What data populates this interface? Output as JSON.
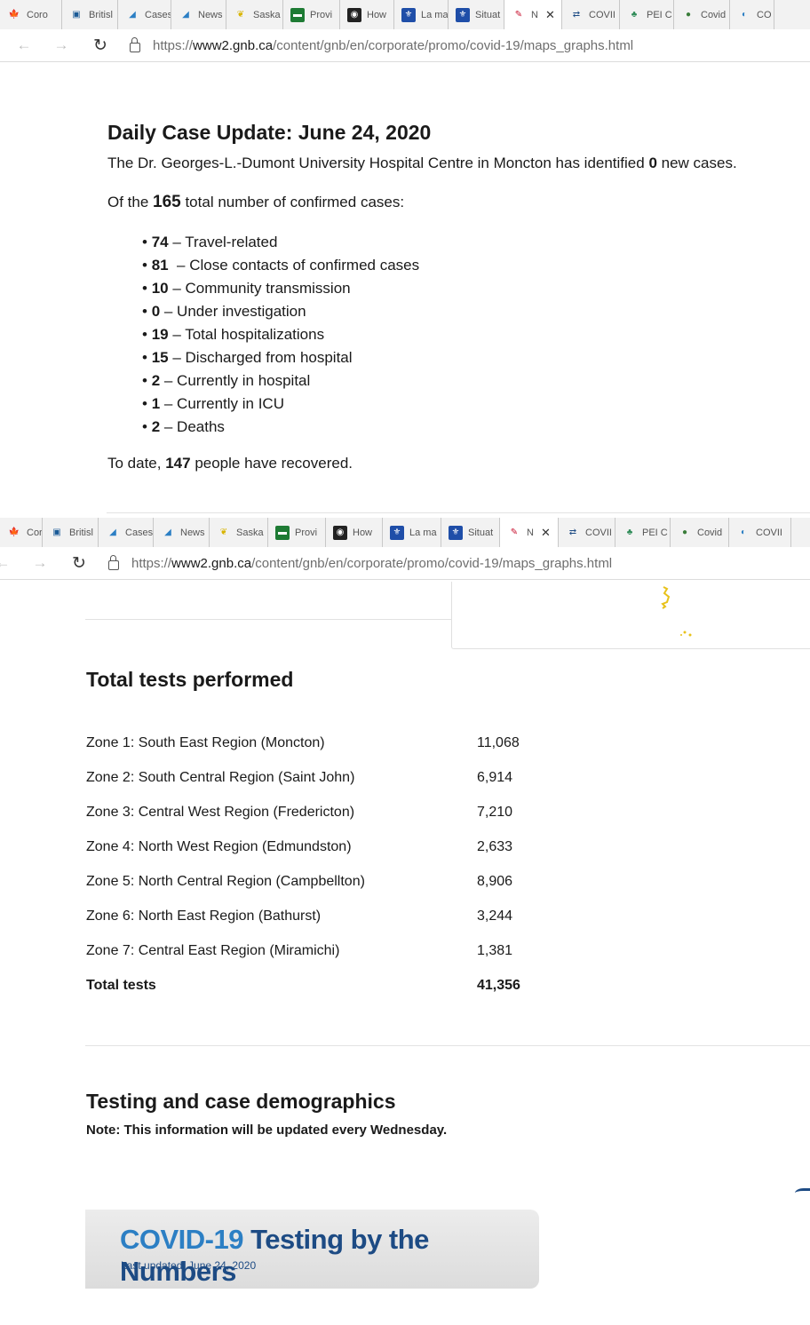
{
  "browser_top": {
    "tabs": [
      {
        "label": "Coro",
        "icon": "canada-flag-icon",
        "w": 70
      },
      {
        "label": "Britisl",
        "icon": "bc-gov-icon",
        "w": 63
      },
      {
        "label": "Cases",
        "icon": "chart-icon",
        "w": 60
      },
      {
        "label": "News",
        "icon": "chart-icon",
        "w": 62
      },
      {
        "label": "Saska",
        "icon": "sask-icon",
        "w": 64
      },
      {
        "label": "Provi",
        "icon": "prov-icon",
        "w": 64
      },
      {
        "label": "How",
        "icon": "shield-icon",
        "w": 61
      },
      {
        "label": "La ma",
        "icon": "quebec-icon",
        "w": 61
      },
      {
        "label": "Situat",
        "icon": "quebec-icon",
        "w": 63
      },
      {
        "label": "N",
        "icon": "nb-icon",
        "w": 65,
        "active": true
      },
      {
        "label": "COVII",
        "icon": "newfoundland-icon",
        "w": 65
      },
      {
        "label": "PEI C",
        "icon": "pei-icon",
        "w": 61
      },
      {
        "label": "Covid",
        "icon": "globe-icon",
        "w": 63
      },
      {
        "label": "CO",
        "icon": "nunavut-icon",
        "w": 50
      }
    ],
    "url_prefix": "https://",
    "url_domain": "www2.gnb.ca",
    "url_path": "/content/gnb/en/corporate/promo/covid-19/maps_graphs.html"
  },
  "browser_mid": {
    "tabs": [
      {
        "label": "Coro",
        "icon": "canada-flag-icon",
        "w": 48
      },
      {
        "label": "Britisl",
        "icon": "bc-gov-icon",
        "w": 63
      },
      {
        "label": "Cases",
        "icon": "chart-icon",
        "w": 62
      },
      {
        "label": "News",
        "icon": "chart-icon",
        "w": 63
      },
      {
        "label": "Saska",
        "icon": "sask-icon",
        "w": 66
      },
      {
        "label": "Provi",
        "icon": "prov-icon",
        "w": 65
      },
      {
        "label": "How",
        "icon": "shield-icon",
        "w": 64
      },
      {
        "label": "La ma",
        "icon": "quebec-icon",
        "w": 66
      },
      {
        "label": "Situat",
        "icon": "quebec-icon",
        "w": 66
      },
      {
        "label": "N",
        "icon": "nb-icon",
        "w": 66,
        "active": true
      },
      {
        "label": "COVII",
        "icon": "newfoundland-icon",
        "w": 64
      },
      {
        "label": "PEI C",
        "icon": "pei-icon",
        "w": 62
      },
      {
        "label": "Covid",
        "icon": "globe-icon",
        "w": 66
      },
      {
        "label": "COVII",
        "icon": "nunavut-icon",
        "w": 70
      }
    ],
    "url_prefix": "https://",
    "url_domain": "www2.gnb.ca",
    "url_path": "/content/gnb/en/corporate/promo/covid-19/maps_graphs.html"
  },
  "daily": {
    "title": "Daily Case Update: June 24, 2020",
    "line1_pre": "The Dr. Georges-L.-Dumont University Hospital Centre in Moncton has identified ",
    "line1_num": "0",
    "line1_post": " new cases.",
    "line2_pre": "Of the ",
    "line2_num": "165",
    "line2_post": " total number of confirmed cases:",
    "bullets": [
      {
        "num": "74",
        "text": " – Travel-related"
      },
      {
        "num": "81",
        "text": "  – Close contacts of confirmed cases"
      },
      {
        "num": "10",
        "text": " – Community transmission"
      },
      {
        "num": "0",
        "text": " – Under investigation"
      },
      {
        "num": "19",
        "text": " – Total hospitalizations"
      },
      {
        "num": "15",
        "text": " – Discharged from hospital"
      },
      {
        "num": "2",
        "text": " – Currently in hospital"
      },
      {
        "num": "1",
        "text": " – Currently in ICU"
      },
      {
        "num": "2",
        "text": " – Deaths"
      }
    ],
    "recovered_pre": "To date, ",
    "recovered_num": "147",
    "recovered_post": " people have recovered."
  },
  "tests": {
    "title": "Total tests performed",
    "rows": [
      {
        "zone": "Zone 1: South East Region (Moncton)",
        "value": "11,068"
      },
      {
        "zone": "Zone 2: South Central Region (Saint John)",
        "value": "6,914"
      },
      {
        "zone": "Zone 3: Central West Region (Fredericton)",
        "value": "7,210"
      },
      {
        "zone": "Zone 4: North West Region (Edmundston)",
        "value": "2,633"
      },
      {
        "zone": "Zone 5: North Central Region (Campbellton)",
        "value": "8,906"
      },
      {
        "zone": "Zone 6: North East Region (Bathurst)",
        "value": "3,244"
      },
      {
        "zone": "Zone 7: Central East Region (Miramichi)",
        "value": "1,381"
      }
    ],
    "total_label": "Total tests",
    "total_value": "41,356"
  },
  "demographics": {
    "title": "Testing and case demographics",
    "note": "Note: This information will be updated every Wednesday."
  },
  "banner": {
    "title_a": "COVID-19",
    "title_b": " Testing by the Numbers",
    "subtitle": "Last updated: June 24, 2020"
  },
  "colors": {
    "brand_dark": "#1d4b84",
    "brand_light": "#2c7fc4",
    "map_yellow": "#e8c21a"
  }
}
